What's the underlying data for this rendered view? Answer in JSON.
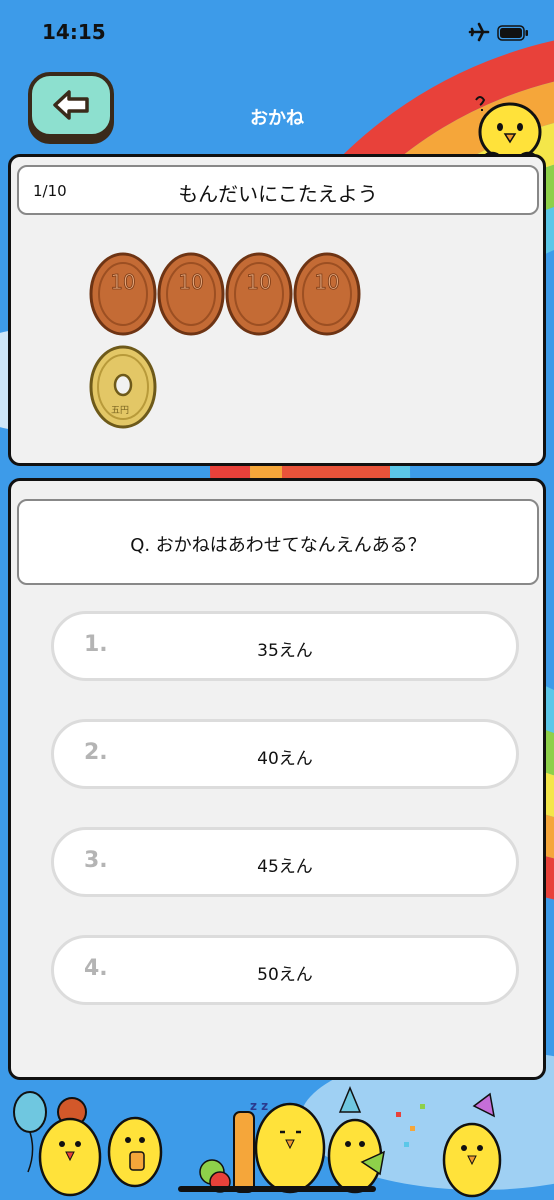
{
  "status": {
    "time": "14:15"
  },
  "nav": {
    "title": "おかね"
  },
  "quiz": {
    "progress": "1/10",
    "instruction": "もんだいにこたえよう",
    "coins": [
      "10",
      "10",
      "10",
      "10",
      "5"
    ],
    "coin_marks": {
      "ten": "10",
      "five": "五円"
    },
    "question": "Q. おかねはあわせてなんえんある？",
    "answers": [
      {
        "num": "1.",
        "label": "35えん"
      },
      {
        "num": "2.",
        "label": "40えん"
      },
      {
        "num": "3.",
        "label": "45えん"
      },
      {
        "num": "4.",
        "label": "50えん"
      }
    ]
  },
  "icons": [
    "airplane-icon",
    "battery-icon",
    "back-arrow-icon",
    "chick-icon"
  ],
  "colors": {
    "background": "#3d9be9",
    "back_button": "#8de0cf",
    "coin_copper": "#c46b35",
    "coin_gold": "#e3c766"
  }
}
